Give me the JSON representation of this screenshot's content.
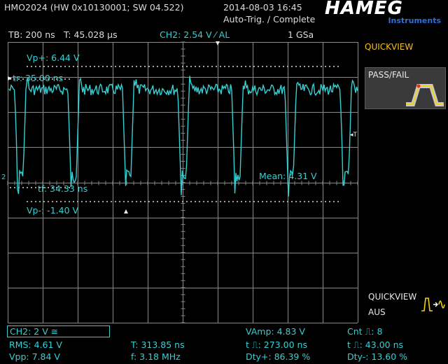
{
  "header": {
    "device": "HMO2024 (HW 0x10130001; SW 04.522)",
    "datetime": "2014-08-03 16:45",
    "trigger_status": "Auto-Trig. / Complete",
    "brand": "HAMEG",
    "brand_sub": "Instruments"
  },
  "settings": {
    "timebase": "TB: 200 ns",
    "trigger_time": "T: 45.028 µs",
    "trigger_channel": "CH2: 2.54 V ⁄ AL",
    "sample_rate": "1 GSa"
  },
  "cursors": {
    "vp_plus": "Vp+: 6.44 V",
    "tr": "tr: 35.00 ns",
    "tf": "tf: 34.33 ns",
    "vp_minus": "Vp-: -1.40 V",
    "mean": "Mean: 4.31 V"
  },
  "side_menu": {
    "quickview": "QUICKVIEW",
    "passfail": "PASS/FAIL",
    "quickview_bottom": "QUICKVIEW",
    "aus": "AUS"
  },
  "footer": {
    "channel": "CH2: 2 V ≅",
    "rms": "RMS: 4.61 V",
    "vpp": "Vpp: 7.84 V",
    "period": "T: 313.85 ns",
    "freq": "f: 3.18 MHz",
    "vamp": "VAmp: 4.83 V",
    "pos_width": "t ⎍: 273.00 ns",
    "dty_plus": "Dty+: 86.39 %",
    "cnt": "Cnt ⎍: 8",
    "neg_width": "t ⎍: 43.00 ns",
    "dty_minus": "Dty-: 13.60 %"
  },
  "colors": {
    "trace": "#34d1d4",
    "grid": "#8a8a8a",
    "background": "#000000",
    "text": "#e0e0e0"
  }
}
